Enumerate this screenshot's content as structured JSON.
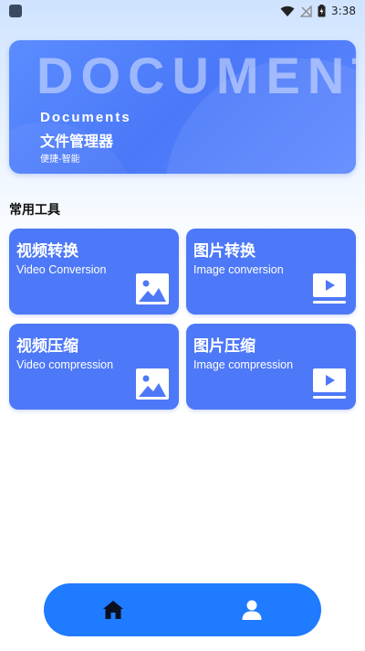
{
  "status_bar": {
    "time": "3:38",
    "icons": [
      "app-indicator-icon",
      "wifi-icon",
      "no-signal-icon",
      "battery-charging-icon"
    ]
  },
  "banner": {
    "watermark": "DOCUMENTS",
    "title": "Documents",
    "subtitle": "文件管理器",
    "tagline": "便捷-智能"
  },
  "section": {
    "title": "常用工具"
  },
  "cards": [
    {
      "title": "视频转换",
      "subtitle": "Video Conversion",
      "icon": "image-icon"
    },
    {
      "title": "图片转换",
      "subtitle": "Image conversion",
      "icon": "video-play-icon"
    },
    {
      "title": "视频压缩",
      "subtitle": "Video compression",
      "icon": "image-icon"
    },
    {
      "title": "图片压缩",
      "subtitle": "Image compression",
      "icon": "video-play-icon"
    }
  ],
  "bottom_nav": {
    "items": [
      "home-icon",
      "profile-icon"
    ]
  },
  "colors": {
    "card": "#4d78f7",
    "nav": "#1f7bff",
    "banner": "#5b8cff"
  }
}
